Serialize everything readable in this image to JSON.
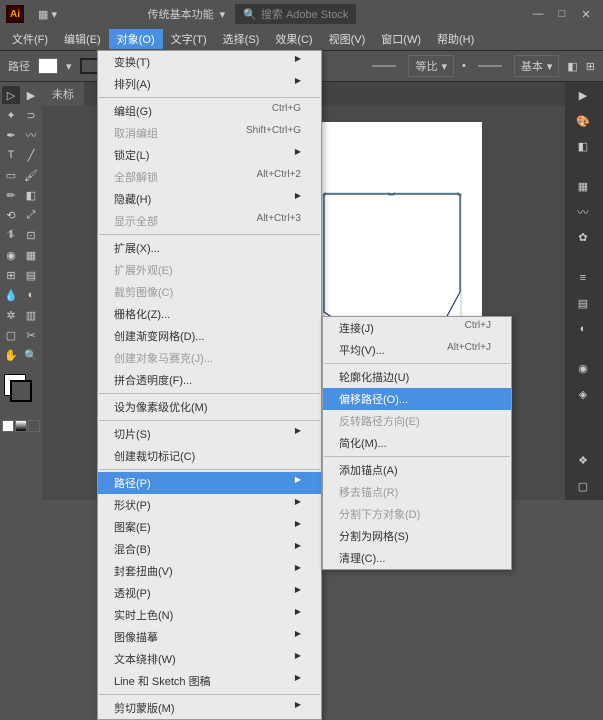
{
  "app": {
    "logo": "Ai"
  },
  "workspace": {
    "label": "传统基本功能"
  },
  "search": {
    "placeholder": "搜索 Adobe Stock"
  },
  "menubar": {
    "file": "文件(F)",
    "edit": "编辑(E)",
    "object": "对象(O)",
    "type": "文字(T)",
    "select": "选择(S)",
    "effect": "效果(C)",
    "view": "视图(V)",
    "window": "窗口(W)",
    "help": "帮助(H)"
  },
  "optbar": {
    "path_label": "路径",
    "dengbi": "等比",
    "basic": "基本"
  },
  "doc": {
    "tab": "未标"
  },
  "dropdown": {
    "transform": "变换(T)",
    "arrange": "排列(A)",
    "group": "编组(G)",
    "group_sc": "Ctrl+G",
    "ungroup": "取消编组",
    "ungroup_sc": "Shift+Ctrl+G",
    "lock": "锁定(L)",
    "unlock": "全部解锁",
    "unlock_sc": "Alt+Ctrl+2",
    "hide": "隐藏(H)",
    "showall": "显示全部",
    "showall_sc": "Alt+Ctrl+3",
    "expand": "扩展(X)...",
    "expand_appearance": "扩展外观(E)",
    "crop_image": "裁剪图像(C)",
    "rasterize": "栅格化(Z)...",
    "gradient_mesh": "创建渐变网格(D)...",
    "mosaic": "创建对象马赛克(J)...",
    "flatten": "拼合透明度(F)...",
    "pixel_perfect": "设为像素级优化(M)",
    "slice": "切片(S)",
    "trim_marks": "创建裁切标记(C)",
    "path": "路径(P)",
    "shape": "形状(P)",
    "pattern": "图案(E)",
    "blend": "混合(B)",
    "envelope": "封套扭曲(V)",
    "perspective": "透视(P)",
    "live_paint": "实时上色(N)",
    "image_trace": "图像描摹",
    "text_wrap": "文本绕排(W)",
    "line_sketch": "Line 和 Sketch 图稿",
    "clip_mask": "剪切蒙版(M)"
  },
  "submenu": {
    "join": "连接(J)",
    "join_sc": "Ctrl+J",
    "average": "平均(V)...",
    "average_sc": "Alt+Ctrl+J",
    "outline_stroke": "轮廓化描边(U)",
    "offset_path": "偏移路径(O)...",
    "reverse": "反转路径方向(E)",
    "simplify": "简化(M)...",
    "add_anchor": "添加锚点(A)",
    "remove_anchor": "移去锚点(R)",
    "divide_below": "分割下方对象(D)",
    "split_grid": "分割为网格(S)",
    "cleanup": "清理(C)..."
  }
}
